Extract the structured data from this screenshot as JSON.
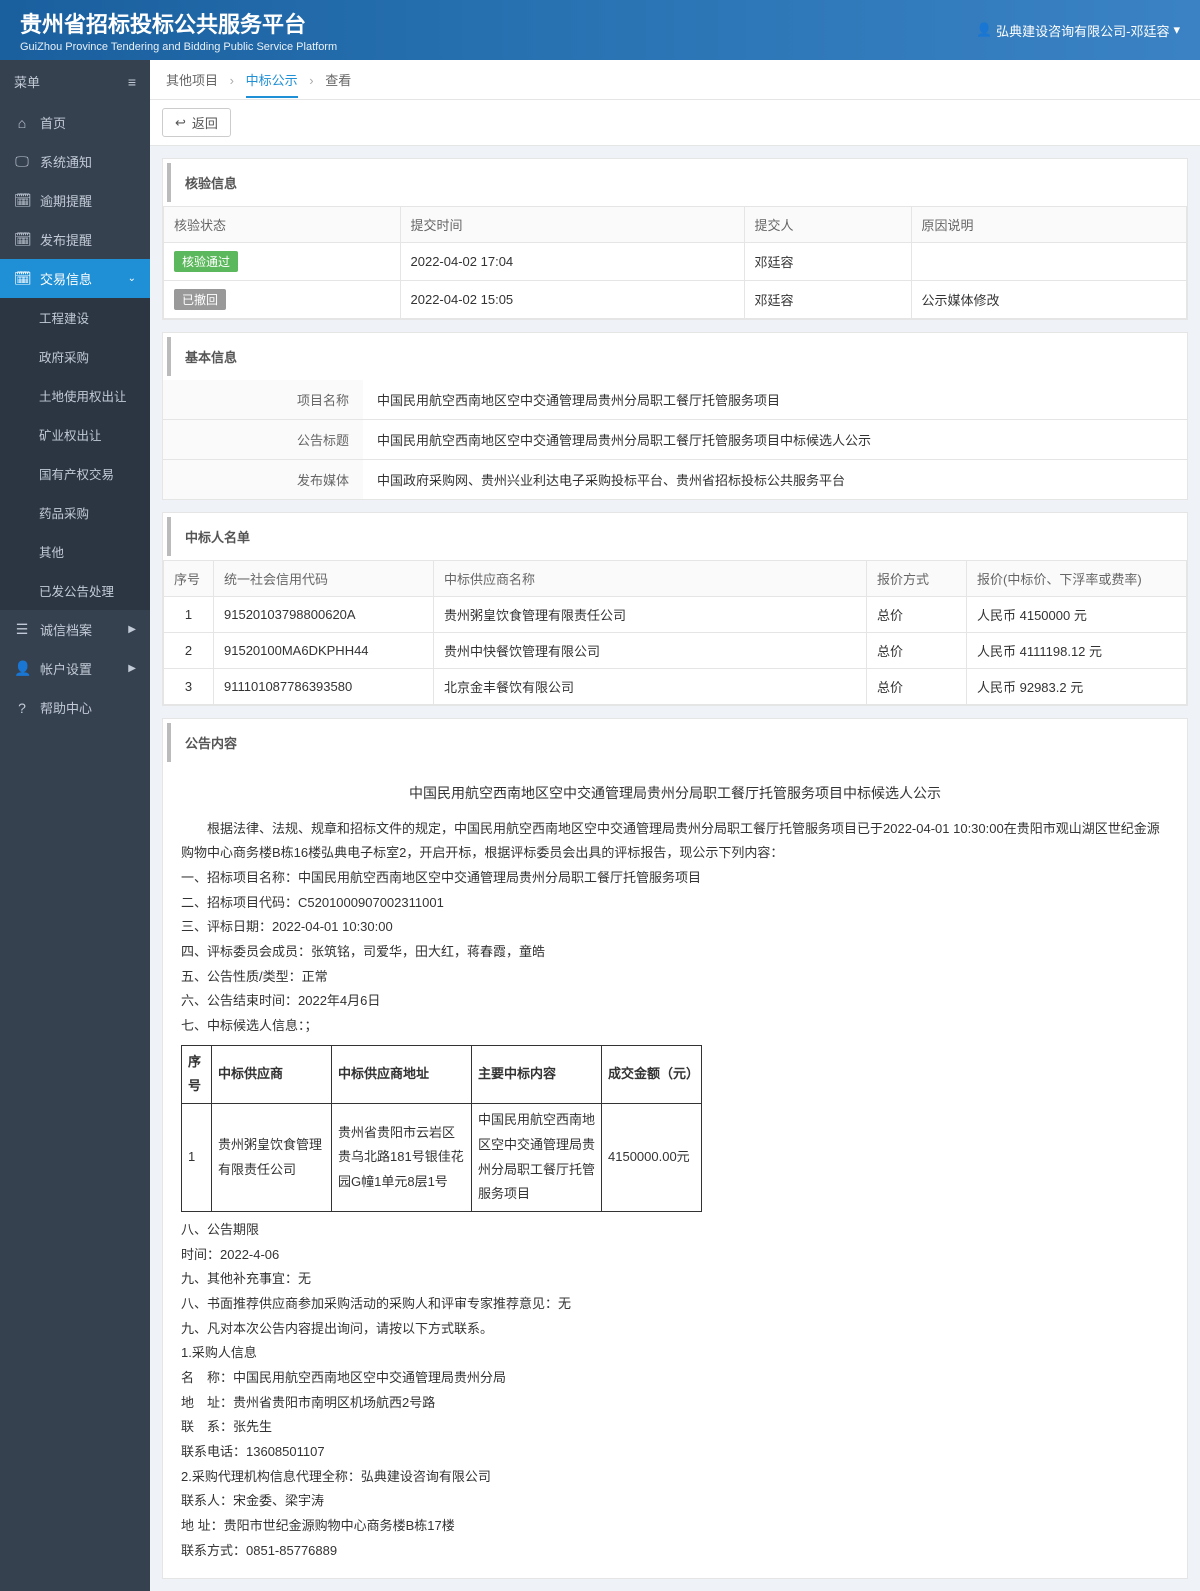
{
  "header": {
    "title": "贵州省招标投标公共服务平台",
    "subtitle": "GuiZhou Province Tendering and Bidding Public Service Platform",
    "user_prefix": "弘典建设咨询有限公司-邓廷容"
  },
  "sidebar": {
    "menu_label": "菜单",
    "items": [
      {
        "icon": "⌂",
        "label": "首页"
      },
      {
        "icon": "🖵",
        "label": "系统通知"
      },
      {
        "icon": "🗓",
        "label": "逾期提醒"
      },
      {
        "icon": "🗓",
        "label": "发布提醒"
      },
      {
        "icon": "🗓",
        "label": "交易信息",
        "active": true,
        "expanded": true
      },
      {
        "icon": "☰",
        "label": "诚信档案",
        "chev": "▶"
      },
      {
        "icon": "👤",
        "label": "帐户设置",
        "chev": "▶"
      },
      {
        "icon": "?",
        "label": "帮助中心"
      }
    ],
    "subitems": [
      "工程建设",
      "政府采购",
      "土地使用权出让",
      "矿业权出让",
      "国有产权交易",
      "药品采购",
      "其他",
      "已发公告处理"
    ]
  },
  "breadcrumb": {
    "a": "其他项目",
    "b": "中标公示",
    "c": "查看"
  },
  "back_label": "返回",
  "verify": {
    "title": "核验信息",
    "headers": [
      "核验状态",
      "提交时间",
      "提交人",
      "原因说明"
    ],
    "rows": [
      {
        "status": "核验通过",
        "status_cls": "green",
        "time": "2022-04-02 17:04",
        "person": "邓廷容",
        "reason": ""
      },
      {
        "status": "已撤回",
        "status_cls": "gray",
        "time": "2022-04-02 15:05",
        "person": "邓廷容",
        "reason": "公示媒体修改"
      }
    ]
  },
  "basic": {
    "title": "基本信息",
    "rows": [
      {
        "label": "项目名称",
        "value": "中国民用航空西南地区空中交通管理局贵州分局职工餐厅托管服务项目"
      },
      {
        "label": "公告标题",
        "value": "中国民用航空西南地区空中交通管理局贵州分局职工餐厅托管服务项目中标候选人公示"
      },
      {
        "label": "发布媒体",
        "value": "中国政府采购网、贵州兴业利达电子采购投标平台、贵州省招标投标公共服务平台"
      }
    ]
  },
  "winners": {
    "title": "中标人名单",
    "headers": [
      "序号",
      "统一社会信用代码",
      "中标供应商名称",
      "报价方式",
      "报价(中标价、下浮率或费率)"
    ],
    "rows": [
      {
        "no": "1",
        "code": "91520103798800620A",
        "name": "贵州粥皇饮食管理有限责任公司",
        "method": "总价",
        "price": "人民币 4150000 元"
      },
      {
        "no": "2",
        "code": "91520100MA6DKPHH44",
        "name": "贵州中快餐饮管理有限公司",
        "method": "总价",
        "price": "人民币 4111198.12 元"
      },
      {
        "no": "3",
        "code": "911101087786393580",
        "name": "北京金丰餐饮有限公司",
        "method": "总价",
        "price": "人民币 92983.2 元"
      }
    ]
  },
  "announcement": {
    "title": "公告内容",
    "doc_title": "中国民用航空西南地区空中交通管理局贵州分局职工餐厅托管服务项目中标候选人公示",
    "para_intro": "　　根据法律、法规、规章和招标文件的规定，中国民用航空西南地区空中交通管理局贵州分局职工餐厅托管服务项目已于2022-04-01 10:30:00在贵阳市观山湖区世纪金源购物中心商务楼B栋16楼弘典电子标室2，开启开标，根据评标委员会出具的评标报告，现公示下列内容：",
    "l1": "一、招标项目名称：中国民用航空西南地区空中交通管理局贵州分局职工餐厅托管服务项目",
    "l2": "二、招标项目代码：C5201000907002311001",
    "l3": "三、评标日期：2022-04-01 10:30:00",
    "l4": "四、评标委员会成员：张筑铭，司爱华，田大红，蒋春霞，童皓",
    "l5": "五、公告性质/类型：正常",
    "l6": "六、公告结束时间：2022年4月6日",
    "l7": "七、中标候选人信息：；",
    "inner_headers": [
      "序号",
      "中标供应商",
      "中标供应商地址",
      "主要中标内容",
      "成交金额（元）"
    ],
    "inner_row": {
      "no": "1",
      "sup": "贵州粥皇饮食管理有限责任公司",
      "addr": "贵州省贵阳市云岩区贵乌北路181号银佳花园G幢1单元8层1号",
      "content": "中国民用航空西南地区空中交通管理局贵州分局职工餐厅托管服务项目",
      "amount": "4150000.00元"
    },
    "rest": [
      "八、公告期限",
      "时间：2022-4-06",
      "九、其他补充事宜：无",
      "八、书面推荐供应商参加采购活动的采购人和评审专家推荐意见：无",
      "九、凡对本次公告内容提出询问，请按以下方式联系。",
      "1.采购人信息",
      "名　称：中国民用航空西南地区空中交通管理局贵州分局",
      "地　址：贵州省贵阳市南明区机场航西2号路",
      "联　系：张先生",
      "联系电话：13608501107",
      "2.采购代理机构信息代理全称：弘典建设咨询有限公司",
      "联系人：宋金委、梁宇涛",
      "地 址：贵阳市世纪金源购物中心商务楼B栋17楼",
      "联系方式：0851-85776889"
    ]
  }
}
